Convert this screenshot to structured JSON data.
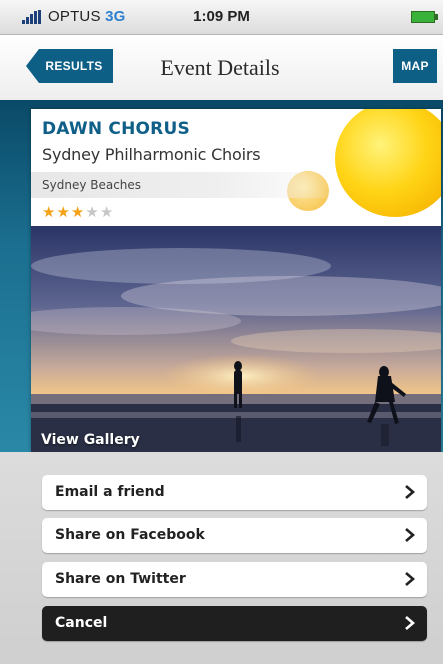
{
  "status_bar": {
    "carrier": "OPTUS",
    "network": "3G",
    "time": "1:09 PM",
    "icons": [
      "signal-icon",
      "battery-icon"
    ]
  },
  "nav": {
    "back_label": "RESULTS",
    "title": "Event Details",
    "map_label": "MAP"
  },
  "event": {
    "title": "DAWN CHORUS",
    "subtitle": "Sydney Philharmonic Choirs",
    "location": "Sydney Beaches",
    "rating": {
      "value": 3,
      "max": 5
    },
    "gallery_label": "View Gallery"
  },
  "actions": [
    {
      "label": "Email a friend",
      "style": "light"
    },
    {
      "label": "Share on Facebook",
      "style": "light"
    },
    {
      "label": "Share on Twitter",
      "style": "light"
    },
    {
      "label": "Cancel",
      "style": "dark"
    }
  ],
  "colors": {
    "accent": "#0e5f86",
    "title_blue": "#0f5f88",
    "star_on": "#f3a21a",
    "star_off": "#c7c7c7",
    "cancel_bg": "#1f1f1f"
  }
}
